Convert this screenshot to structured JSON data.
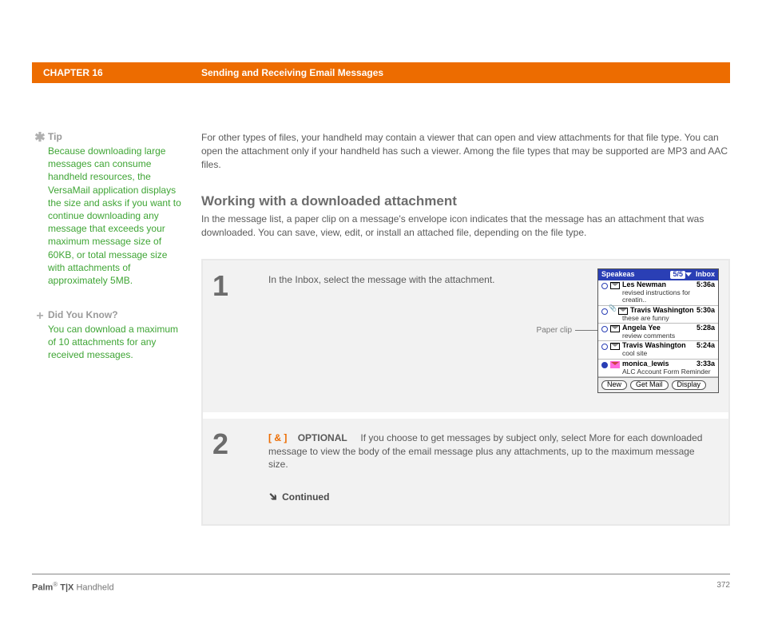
{
  "header": {
    "chapter": "CHAPTER 16",
    "title": "Sending and Receiving Email Messages"
  },
  "sidebar": {
    "tip": {
      "heading": "Tip",
      "body": "Because downloading large messages can consume handheld resources, the VersaMail application displays the size and asks if you want to continue downloading any message that exceeds your maximum message size of 60KB, or total message size with attachments of approximately 5MB."
    },
    "dyk": {
      "heading": "Did You Know?",
      "body": "You can download a maximum of 10 attachments for any received messages."
    }
  },
  "main": {
    "intro": "For other types of files, your handheld may contain a viewer that can open and view attachments for that file type. You can open the attachment only if your handheld has such a viewer. Among the file types that may be supported are MP3 and AAC files.",
    "heading": "Working with a downloaded attachment",
    "body": "In the message list, a paper clip on a message's envelope icon indicates that the message has an attachment that was downloaded. You can save, view, edit, or install an attached file, depending on the file type."
  },
  "steps": {
    "s1": {
      "num": "1",
      "text": "In the Inbox, select the message with the attachment.",
      "callout": "Paper clip"
    },
    "s2": {
      "num": "2",
      "badge": "[ & ]",
      "optional": "OPTIONAL",
      "text": "If you choose to get messages by subject only, select More for each downloaded message to view the body of the email message plus any attachments, up to the maximum message size.",
      "continued": "Continued"
    }
  },
  "palm": {
    "account": "Speakeas",
    "count": "5/5",
    "folder": "Inbox",
    "rows": [
      {
        "sender": "Les Newman",
        "time": "5:36a",
        "subj": "revised instructions for creatin..",
        "clip": false,
        "pink": false,
        "filled": false
      },
      {
        "sender": "Travis Washington",
        "time": "5:30a",
        "subj": "these are funny",
        "clip": true,
        "pink": false,
        "filled": false
      },
      {
        "sender": "Angela Yee",
        "time": "5:28a",
        "subj": "review comments",
        "clip": false,
        "pink": false,
        "filled": false
      },
      {
        "sender": "Travis Washington",
        "time": "5:24a",
        "subj": "cool site",
        "clip": false,
        "pink": false,
        "filled": false
      },
      {
        "sender": "monica_lewis",
        "time": "3:33a",
        "subj": "ALC Account Form Reminder",
        "clip": false,
        "pink": true,
        "filled": true
      }
    ],
    "buttons": [
      "New",
      "Get Mail",
      "Display"
    ]
  },
  "footer": {
    "brand": "Palm",
    "model": " T|X",
    "suffix": " Handheld",
    "page": "372"
  }
}
